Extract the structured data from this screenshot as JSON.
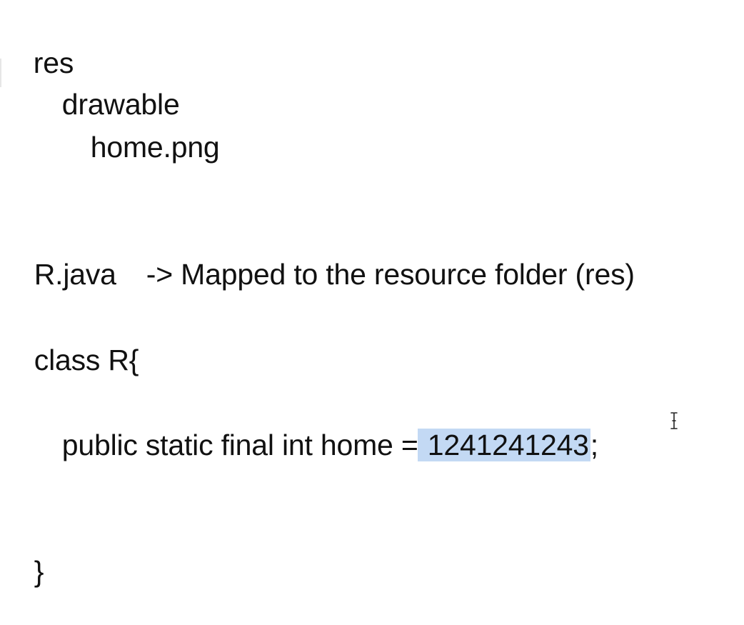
{
  "document": {
    "lines": {
      "res": "res",
      "drawable": "drawable",
      "home_png": "home.png",
      "r_java": "R.java",
      "mapping": "-> Mapped to the resource folder (res)",
      "class_open": "class R{",
      "field_prefix": "public static final int home = ",
      "field_value": "1241241243",
      "field_suffix": ";",
      "class_close": "}"
    }
  },
  "colors": {
    "text": "#111111",
    "selection_highlight": "#c3d9f4",
    "background": "#ffffff"
  },
  "icons": {
    "cursor": "text-cursor-ibeam-icon"
  }
}
